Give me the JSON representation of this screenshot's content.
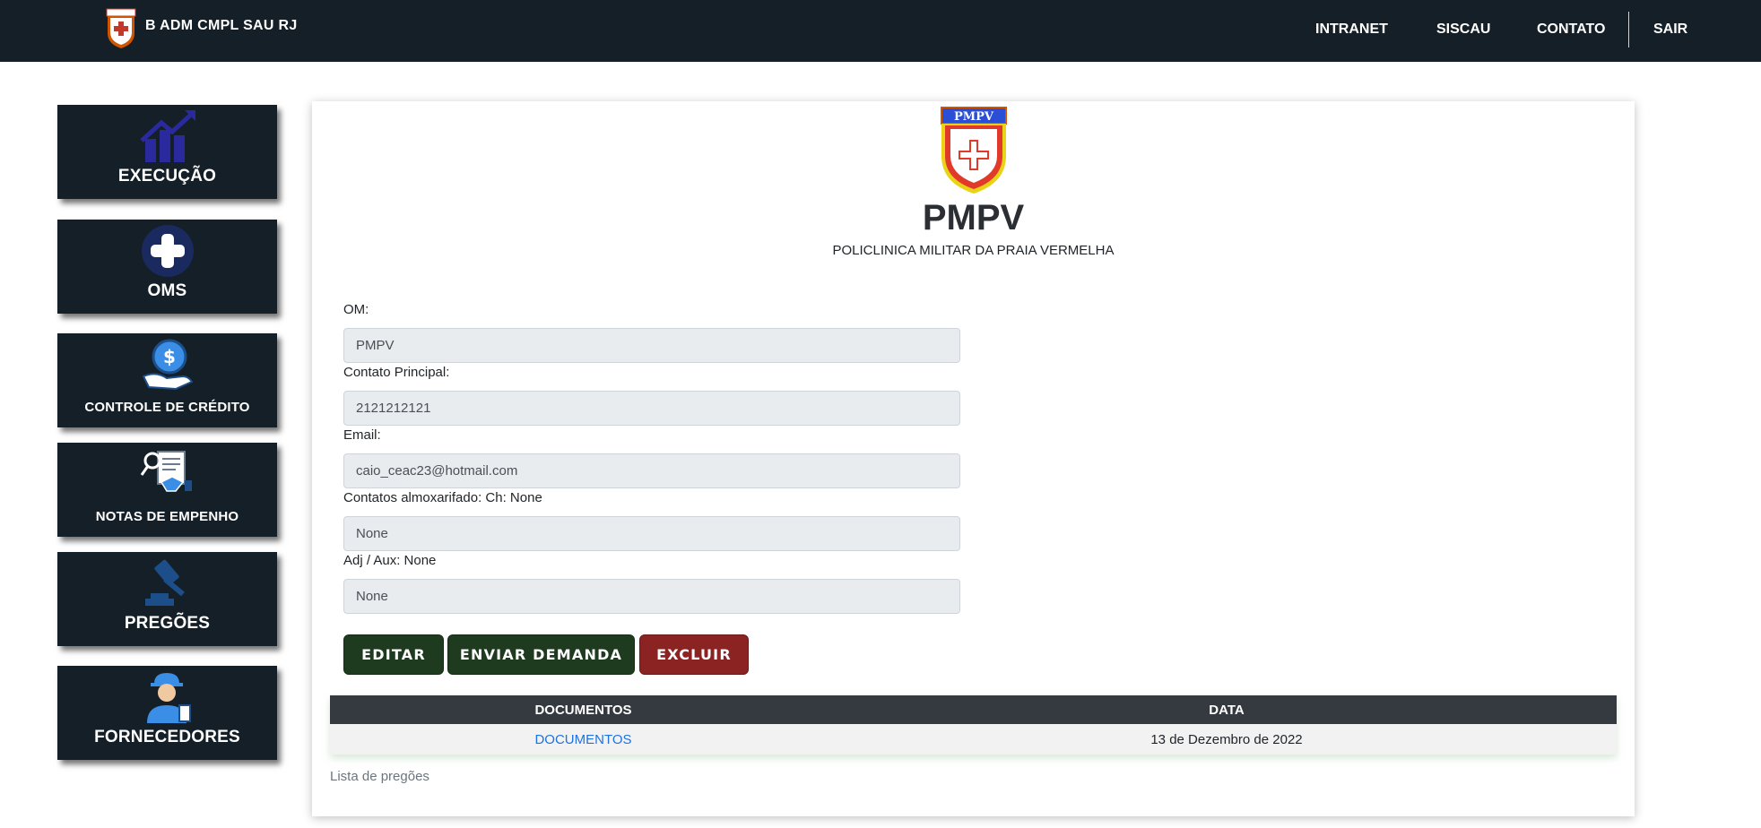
{
  "navbar": {
    "brand_title": "B ADM CMPL SAU RJ",
    "links": {
      "intranet": "INTRANET",
      "siscau": "SISCAU",
      "contato": "CONTATO",
      "sair": "SAIR"
    }
  },
  "sidebar": {
    "items": [
      {
        "label": "EXECUÇÃO",
        "icon": "chart-growth-icon"
      },
      {
        "label": "OMS",
        "icon": "medical-cross-icon"
      },
      {
        "label": "CONTROLE DE CRÉDITO",
        "icon": "coin-hand-icon"
      },
      {
        "label": "NOTAS DE EMPENHO",
        "icon": "document-handshake-icon"
      },
      {
        "label": "PREGÕES",
        "icon": "gavel-icon"
      },
      {
        "label": "FORNECEDORES",
        "icon": "worker-icon"
      }
    ]
  },
  "main": {
    "logo_text": "PMPV",
    "title": "PMPV",
    "subtitle": "POLICLINICA MILITAR DA PRAIA VERMELHA",
    "fields": [
      {
        "label": "OM:",
        "value": "PMPV"
      },
      {
        "label": "Contato Principal:",
        "value": "2121212121"
      },
      {
        "label": "Email:",
        "value": "caio_ceac23@hotmail.com"
      },
      {
        "label": "Contatos almoxarifado: Ch: None",
        "value": "None"
      },
      {
        "label": "Adj / Aux: None",
        "value": "None"
      }
    ],
    "buttons": {
      "editar": "EDITAR",
      "enviar": "ENVIAR DEMANDA",
      "excluir": "EXCLUIR"
    },
    "table": {
      "headers": [
        "DOCUMENTOS",
        "DATA"
      ],
      "rows": [
        {
          "documentos": "DOCUMENTOS",
          "data": "13 de Dezembro de 2022"
        }
      ]
    },
    "caption": "Lista de pregões"
  },
  "colors": {
    "navbar": "#141f27",
    "btn_green": "#1e3b1f",
    "btn_red": "#8c2323",
    "link": "#1f73e0"
  }
}
